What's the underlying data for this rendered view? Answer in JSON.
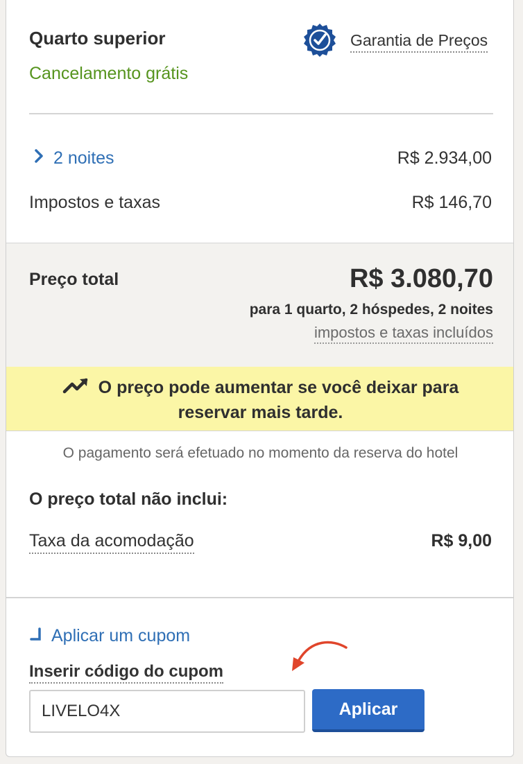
{
  "room": {
    "title": "Quarto superior",
    "cancellation": "Cancelamento grátis",
    "price_guarantee": "Garantia de Preços"
  },
  "summary": {
    "nights_label": "2 noites",
    "nights_price": "R$ 2.934,00",
    "taxes_label": "Impostos e taxas",
    "taxes_price": "R$ 146,70"
  },
  "total": {
    "label": "Preço total",
    "price": "R$ 3.080,70",
    "detail": "para 1 quarto, 2 hóspedes, 2 noites",
    "included_note": "impostos e taxas incluídos"
  },
  "alert": {
    "line1": "O preço pode aumentar se você deixar para",
    "line2": "reservar mais tarde.",
    "icon": "trending-up-icon"
  },
  "payment_note": "O pagamento será efetuado no momento da reserva do hotel",
  "not_included": {
    "heading": "O preço total não inclui:",
    "fee_label": "Taxa da acomodação",
    "fee_price": "R$ 9,00"
  },
  "coupon": {
    "toggle_label": "Aplicar um cupom",
    "field_label": "Inserir código do cupom",
    "value": "LIVELO4X",
    "apply_label": "Aplicar"
  },
  "colors": {
    "link": "#2f6fb5",
    "success": "#56941e",
    "alert_bg": "#fbf6a6",
    "button": "#2d6bc6",
    "annotation_arrow": "#e0452b"
  }
}
